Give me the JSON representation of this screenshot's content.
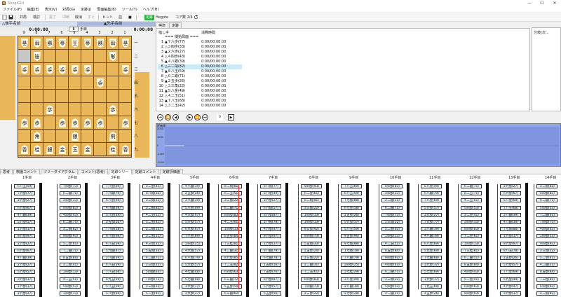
{
  "app": {
    "title": "ShogiGUI"
  },
  "window": {
    "minimize_label": "—",
    "maximize_label": "☐",
    "close_label": "✕"
  },
  "menu": [
    "ファイル(F)",
    "編集(E)",
    "表示(V)",
    "対局(G)",
    "定跡(J)",
    "局面編集(B)",
    "ツール(T)",
    "ヘルプ(H)"
  ],
  "toolbar": {
    "taikyoku": "対局",
    "kento": "検討",
    "kaishi": "投了",
    "matta": "中断",
    "torikeshi": "取消",
    "sugu": "すぐ",
    "hint": "ヒント",
    "tsume": "詰",
    "stop": "■",
    "mode": "定跡",
    "engine": "Hegote",
    "cpu": "コア数 2/4"
  },
  "players": {
    "gote": "△後手名前",
    "sente": "▲先手名前",
    "gote_time": "0:00:00",
    "sente_time": "0:00:00",
    "move_no": "6",
    "move_unit": "手目"
  },
  "board": {
    "files": [
      "9",
      "8",
      "7",
      "6",
      "5",
      "4",
      "3",
      "2",
      "1"
    ],
    "ranks": [
      "一",
      "二",
      "三",
      "四",
      "五",
      "六",
      "七",
      "八",
      "九"
    ],
    "pieces": [
      {
        "r": 0,
        "c": 0,
        "p": "香",
        "g": true
      },
      {
        "r": 0,
        "c": 1,
        "p": "桂",
        "g": true
      },
      {
        "r": 0,
        "c": 2,
        "p": "銀",
        "g": true
      },
      {
        "r": 0,
        "c": 3,
        "p": "金",
        "g": true
      },
      {
        "r": 0,
        "c": 4,
        "p": "玉",
        "g": true
      },
      {
        "r": 0,
        "c": 5,
        "p": "金",
        "g": true
      },
      {
        "r": 0,
        "c": 6,
        "p": "銀",
        "g": true
      },
      {
        "r": 0,
        "c": 7,
        "p": "桂",
        "g": true
      },
      {
        "r": 0,
        "c": 8,
        "p": "香",
        "g": true
      },
      {
        "r": 1,
        "c": 1,
        "p": "飛",
        "g": true
      },
      {
        "r": 1,
        "c": 7,
        "p": "角",
        "g": true
      },
      {
        "r": 2,
        "c": 0,
        "p": "歩",
        "g": true
      },
      {
        "r": 2,
        "c": 1,
        "p": "歩",
        "g": true
      },
      {
        "r": 2,
        "c": 2,
        "p": "歩",
        "g": true
      },
      {
        "r": 2,
        "c": 3,
        "p": "歩",
        "g": true
      },
      {
        "r": 2,
        "c": 4,
        "p": "歩",
        "g": true
      },
      {
        "r": 2,
        "c": 5,
        "p": "歩",
        "g": true
      },
      {
        "r": 2,
        "c": 8,
        "p": "歩",
        "g": true
      },
      {
        "r": 3,
        "c": 6,
        "p": "歩",
        "g": true
      },
      {
        "r": 5,
        "c": 2,
        "p": "歩",
        "g": false
      },
      {
        "r": 5,
        "c": 7,
        "p": "歩",
        "g": false
      },
      {
        "r": 6,
        "c": 0,
        "p": "歩",
        "g": false
      },
      {
        "r": 6,
        "c": 1,
        "p": "歩",
        "g": false
      },
      {
        "r": 6,
        "c": 3,
        "p": "歩",
        "g": false
      },
      {
        "r": 6,
        "c": 4,
        "p": "歩",
        "g": false
      },
      {
        "r": 6,
        "c": 5,
        "p": "歩",
        "g": false
      },
      {
        "r": 6,
        "c": 6,
        "p": "歩",
        "g": false
      },
      {
        "r": 6,
        "c": 8,
        "p": "歩",
        "g": false
      },
      {
        "r": 7,
        "c": 1,
        "p": "角",
        "g": false
      },
      {
        "r": 7,
        "c": 4,
        "p": "銀",
        "g": false
      },
      {
        "r": 7,
        "c": 7,
        "p": "飛",
        "g": false
      },
      {
        "r": 8,
        "c": 0,
        "p": "香",
        "g": false
      },
      {
        "r": 8,
        "c": 1,
        "p": "桂",
        "g": false
      },
      {
        "r": 8,
        "c": 2,
        "p": "銀",
        "g": false
      },
      {
        "r": 8,
        "c": 3,
        "p": "金",
        "g": false
      },
      {
        "r": 8,
        "c": 4,
        "p": "玉",
        "g": false
      },
      {
        "r": 8,
        "c": 5,
        "p": "金",
        "g": false
      },
      {
        "r": 8,
        "c": 7,
        "p": "桂",
        "g": false
      },
      {
        "r": 8,
        "c": 8,
        "p": "香",
        "g": false
      }
    ]
  },
  "kifu": {
    "tabs": [
      "棋譜",
      "定跡"
    ],
    "header_move": "指し手",
    "header_time": "消費時間",
    "comment_header": "分岐(次...",
    "moves": [
      {
        "n": "",
        "m": "=== 開始局面 ===",
        "t": ""
      },
      {
        "n": "1",
        "m": "▲７六歩(77)",
        "t": "0:00/00:00:00"
      },
      {
        "n": "2",
        "m": "△３四歩(33)",
        "t": "0:00/00:00:00"
      },
      {
        "n": "3",
        "m": "▲２六歩(27)",
        "t": "0:00/00:00:00"
      },
      {
        "n": "4",
        "m": "△４四歩(43)",
        "t": "0:00/00:00:00"
      },
      {
        "n": "5",
        "m": "▲４八銀(39)",
        "t": "0:00/00:00:00"
      },
      {
        "n": "6",
        "m": "△三二飛(82)",
        "t": "0:00/00:00:00"
      },
      {
        "n": "7",
        "m": "▲６八玉(59)",
        "t": "0:00/00:00:00"
      },
      {
        "n": "8",
        "m": "△６二銀(71)",
        "t": "0:00/00:00:00"
      },
      {
        "n": "9",
        "m": "▲２五歩(26)",
        "t": "0:00/00:00:00"
      },
      {
        "n": "10",
        "m": "△３三角(22)",
        "t": "0:00/00:00:00"
      },
      {
        "n": "11",
        "m": "▲５八金(49)",
        "t": "0:00/00:00:00"
      },
      {
        "n": "12",
        "m": "△４二玉(51)",
        "t": "0:00/00:00:00"
      },
      {
        "n": "13",
        "m": "▲７八玉(68)",
        "t": "0:00/00:00:00"
      },
      {
        "n": "14",
        "m": "△３二玉(42)",
        "t": "0:00/00:00:00"
      }
    ]
  },
  "graph": {
    "y_label": "評価値",
    "ticks": [
      "2000",
      "1000",
      "0",
      "-1000",
      "-2000"
    ]
  },
  "bottom_tabs": [
    "思考",
    "棋譜コメント",
    "ツリーダイアグラム",
    "コメント(思考)",
    "定跡ツリー",
    "定跡コメント",
    "定跡評価値"
  ],
  "tree": {
    "headers": [
      "1手目",
      "2手目",
      "3手目",
      "4手目",
      "5手目",
      "6手目",
      "7手目",
      "8手目",
      "9手目",
      "10手目",
      "11手目",
      "12手目",
      "13手目",
      "14手目"
    ],
    "columns": [
      [
        "６八玉(59)",
        "７六歩(77)",
        "２六歩(27)",
        "６六歩(67)",
        "４八銀(39)",
        "５六歩(57)",
        "１六歩(17)",
        "９六歩(97)",
        "２六歩(27)",
        "６六歩(67)",
        "４八銀(39)",
        "２六歩(27)",
        "５六歩(57)",
        "３六歩(37)",
        "１六歩(17)",
        "２六歩(27)"
      ],
      [
        "７四歩(73)",
        "６二銀(71)",
        "３四歩(33)",
        "８四歩(83)",
        "４四歩(43)",
        "６二銀(71)",
        "３二飛(82)",
        "９四歩(93)",
        "５二金(61)",
        "７二銀(71)",
        "８五歩(84)",
        "３二金(41)",
        "１四歩(13)",
        "４二玉(51)",
        "５四歩(53)",
        "１四歩(13)"
      ],
      [
        "７八金(69)",
        "７八銀(79)",
        "６八金(69)",
        "４八銀(39)",
        "５八金(49)",
        "２五歩(26)",
        "７八飛(28)",
        "６八金(69)",
        "４八玉(59)",
        "５六銀(47)",
        "３八銀(39)",
        "６八玉(59)",
        "７八玉(68)",
        "６九玉(59)",
        "５八玉(59)",
        "５八金(69)"
      ],
      [
        "３二金(41)",
        "８八角(22)",
        "３三角(22)",
        "３二飛(82)",
        "４二玉(51)",
        "５二金(41)",
        "２二角(22)",
        "３二金(21)",
        "４三金(32)",
        "５五角(33)",
        "６二銀(71)",
        "３三角(22)",
        "５四銀(63)",
        "７四歩(73)",
        "３三角(22)",
        "５二金(41)"
      ],
      [
        "４八銀(39)",
        "２五歩(26)",
        "３八銀(39)",
        "５八金(49)",
        "４六歩(47)",
        "５六歩(57)",
        "６六歩(67)",
        "７八金(69)",
        "２四歩(25)",
        "４六角(57)",
        "６八角(79)",
        "５六歩(57)",
        "４七銀(48)",
        "５七銀(48)",
        "１六歩(17)",
        "３六歩(37)"
      ],
      [
        "８二飛(81)",
        "６二玉(51)",
        "３三角(22)",
        "６二銀(71)",
        "８四歩(83)",
        "４二玉(61)",
        "１四歩(13)",
        "８五歩(84)",
        "７三桂(81)",
        "４二銀(31)",
        "８六歩(85)",
        "７二玉(82)",
        "６四歩(63)",
        "６三銀(72)",
        "５五歩(54)",
        "６三銀(62)"
      ],
      [
        "８八角(77)",
        "５八金(49)",
        "２六歩(27)",
        "６六角(57)",
        "８六歩(87)",
        "２八飛(78)",
        "４六歩(47)",
        "９六歩(97)",
        "１六歩(17)",
        "８八銀(79)",
        "６七銀(78)",
        "１五歩(16)",
        "７五歩(76)",
        "８六歩(87)",
        "５六歩(57)",
        "５五歩(56)"
      ],
      [
        "９四歩(93)",
        "６二金(61)",
        "８二飛(81)",
        "３三角(22)",
        "１四歩(13)",
        "１四歩(13)",
        "９三歩(92)",
        "８四角(73)",
        "５五角(33)",
        "２五歩(24)",
        "３三角(22)",
        "２二銀(31)",
        "７二玉(61)",
        "８四歩(83)",
        "７四銀(73)",
        "２三歩(22)"
      ],
      [
        "７八玉(69)",
        "６八玉(59)",
        "７七角(88)",
        "６七金(58)",
        "２五歩(26)",
        "５六歩(57)",
        "５八玉(59)",
        "９五歩(96)",
        "９七角(88)",
        "１七香(19)",
        "７八銀(79)",
        "２四歩(25)",
        "３七桂(29)",
        "３八金(49)",
        "２八銀(39)",
        "２七歩(28)"
      ],
      [
        "８四歩(83)",
        "３四歩(33)",
        "２二銀(31)",
        "６二銀(71)",
        "７四歩(73)",
        "１三角(22)",
        "５二金(61)",
        "１四歩(13)",
        "４二玉(51)",
        "８五歩(84)",
        "９四歩(93)",
        "４四歩(43)",
        "６二銀(71)",
        "３三角(22)",
        "５四歩(53)",
        "２二銀(31)"
      ],
      [
        "５八金(49)",
        "６八銀(79)",
        "７八金(69)",
        "５六歩(57)",
        "２六歩(27)",
        "７六歩(77)",
        "３八銀(39)",
        "４八銀(39)",
        "６八金(69)",
        "５九金(69)",
        "７七銀(68)",
        "３六歩(37)",
        "５七金(69)",
        "１六歩(17)",
        "７九玉(69)",
        "２五歩(26)"
      ],
      [
        "６二銀(71)",
        "８二玉(71)",
        "４二玉(51)",
        "５四歩(53)",
        "３二金(41)",
        "３四歩(33)",
        "８四歩(83)",
        "７二金(61)",
        "１四歩(13)",
        "７三桂(81)",
        "６二銀(51)",
        "８五歩(84)",
        "４四歩(43)",
        "５二金(41)",
        "６四歩(63)",
        "９四歩(93)"
      ],
      [
        "２六歩(27)",
        "６六歩(67)",
        "５八金(69)",
        "７八玉(68)",
        "３八銀(39)",
        "４八銀(39)",
        "７七角(88)",
        "１六歩(17)",
        "９六歩(97)",
        "８八玉(78)",
        "２五歩(26)",
        "５六歩(57)",
        "７八金(69)",
        "５九金(49)",
        "４六歩(47)",
        "３六歩(37)"
      ],
      [
        "３二飛(82)",
        "８四歩(83)",
        "６二銀(71)",
        "５四歩(53)",
        "７二銀(61)",
        "７四歩(73)",
        "４四歩(43)",
        "１四歩(13)",
        "９四歩(93)",
        "３三角(22)",
        "５二金(41)",
        "４二銀(31)",
        "８五歩(84)",
        "７三桂(81)",
        "６四歩(63)",
        "２二飛(82)"
      ]
    ]
  }
}
